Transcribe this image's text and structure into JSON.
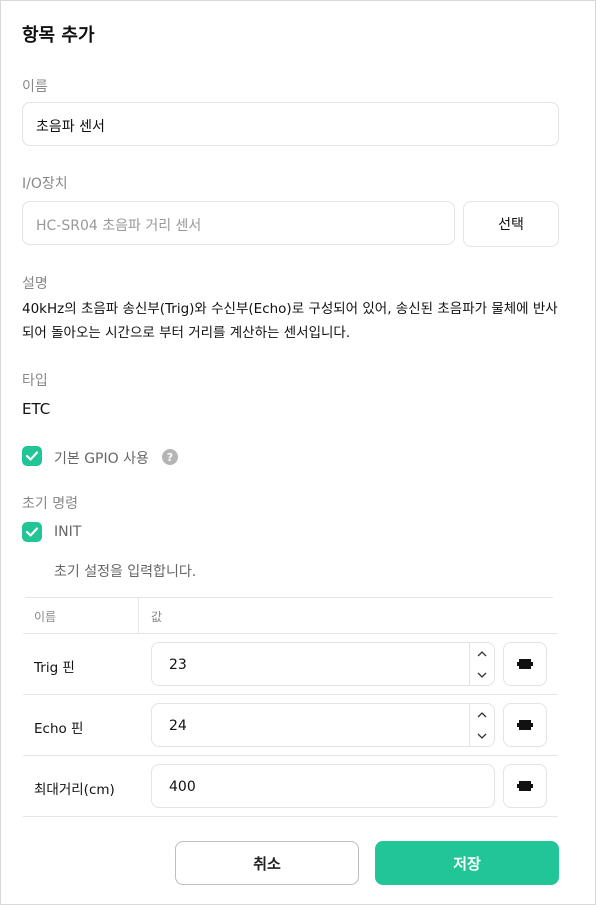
{
  "dialog": {
    "title": "항목 추가"
  },
  "name_field": {
    "label": "이름",
    "value": "초음파 센서"
  },
  "io_field": {
    "label": "I/O장치",
    "placeholder": "HC-SR04 초음파 거리 센서",
    "select_label": "선택"
  },
  "description": {
    "label": "설명",
    "text": "40kHz의 초음파 송신부(Trig)와 수신부(Echo)로 구성되어 있어, 송신된 초음파가 물체에 반사되어 돌아오는 시간으로 부터 거리를 계산하는 센서입니다."
  },
  "type_field": {
    "label": "타입",
    "value": "ETC"
  },
  "gpio": {
    "label": "기본 GPIO 사용",
    "checked": true,
    "help": "?"
  },
  "init": {
    "section_label": "초기 명령",
    "checkbox_label": "INIT",
    "checked": true,
    "helper_text": "초기 설정을 입력합니다.",
    "table": {
      "headers": {
        "name": "이름",
        "value": "값"
      },
      "rows": [
        {
          "label": "Trig 핀",
          "value": "23",
          "has_stepper": true
        },
        {
          "label": "Echo 핀",
          "value": "24",
          "has_stepper": true
        },
        {
          "label": "최대거리(cm)",
          "value": "400",
          "has_stepper": false
        }
      ]
    }
  },
  "footer": {
    "cancel_label": "취소",
    "save_label": "저장"
  },
  "colors": {
    "accent": "#22c596",
    "border": "#e3e3e3",
    "muted_text": "#888888"
  }
}
